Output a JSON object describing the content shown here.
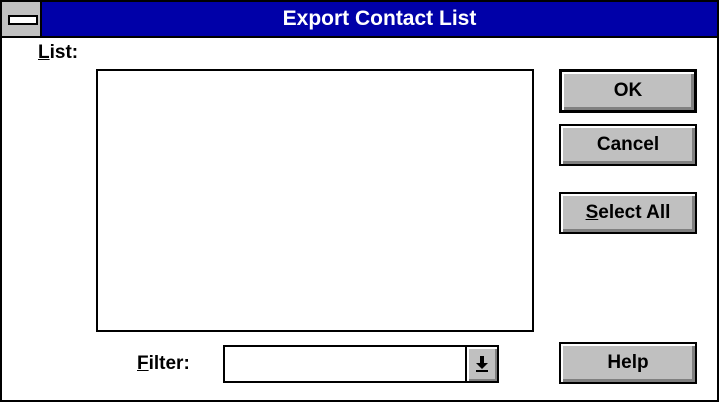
{
  "window": {
    "title": "Export Contact List"
  },
  "list": {
    "label_mnemonic": "L",
    "label_rest": "ist:",
    "items": []
  },
  "filter": {
    "label_mnemonic": "F",
    "label_rest": "ilter:",
    "value": ""
  },
  "buttons": {
    "ok": "OK",
    "cancel": "Cancel",
    "select_all_mnemonic": "S",
    "select_all_rest": "elect All",
    "help": "Help"
  },
  "icons": {
    "system_menu": "system-menu-icon",
    "dropdown": "dropdown-arrow-icon"
  },
  "colors": {
    "titlebar": "#0000a8",
    "button_face": "#c0c0c0"
  }
}
